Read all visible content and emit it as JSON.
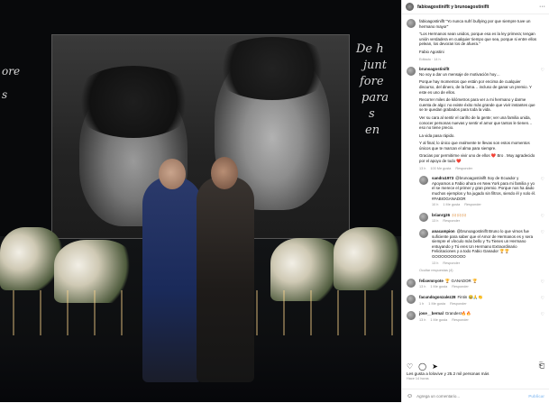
{
  "post": {
    "author": "fabioagostiniflt",
    "collaborator": "brunoagostiniflt",
    "header_text": "fabioagostiniflt y brunoagostiniflt",
    "caption": [
      "fabioagostiniflt \"Yo nunca sufrí bullying por que siempre tuve un hermano mayor\"",
      "\"Los Hermanos sean unidos, porque esa es la ley primera; tengan unión verdadera en cualquier tiempo que sea, porque si entre ellos pelean, los devoran los de afuera.\"",
      "Fabio Agostini"
    ],
    "caption_edit": "Editado · 14 h",
    "overlay_script_right": [
      "De h",
      "junt",
      "fore",
      "para",
      "s",
      "en"
    ],
    "overlay_script_left": [
      "ore",
      "s"
    ]
  },
  "comments": [
    {
      "user": "brunoagostiniflt",
      "paragraphs": [
        "No voy a dar un mensaje de motivación hoy…",
        "Porque hay momentos que están por encima de cualquier discurso, del dinero, de la fama… incluso de ganar un premio. Y este es uno de ellos.",
        "Recorrer miles de kilómetros para ver a mi hermano y darme cuenta de algo: no existe éxito más grande que vivir instantes que se te quedan grabados para toda la vida.",
        "Ver su cara al sentir el cariño de la gente; ver una familia unida, conocer personas nuevas y sentir el amor que tantos le tienen… eso no tiene precio.",
        "La vida pasa rápido.",
        "Y al final, lo único que realmente te llevas son estos momentos únicos que te marcan el alma para siempre.",
        "Gracias por permitirme vivir uno de ellos ❤️ Bro . Muy agradecido por el apoyo de todo ❤️"
      ],
      "time": "13 h",
      "likes": "100 Me gusta",
      "reply": "Responder",
      "replies": [
        {
          "user": "sandra1973",
          "text": "@brunoagostiniflt Soy de Ecuador y Apoyamos a Fabio ahora en New York para mi familia y yo el se merece el primer y gran premio. Porque nos ha dado muchos ejemplos y ha jugado sin filtros, siendo él y solo él. #FABIOGANADOR",
          "time": "10 h",
          "likes": "1 Me gusta",
          "reply": "Responder"
        },
        {
          "user": "brianrg26",
          "text": "🙌🏻🙌🏻🙌🏻",
          "time": "13 h",
          "likes": "",
          "reply": "Responder"
        },
        {
          "user": "anacampion",
          "text": "@brunoagostiniflt Bruno lo que vimos fue suficiente para saber que el Amor de Hermanos es y sera siempre el vínculo más bello y Tu Tienes un Hermano entuyando y Tú eres Un Hermano Extraordinario Felicitaciones y a todo Fabio Ganador 🏆🏆 GOOOOOOOOOO",
          "time": "13 h",
          "likes": "",
          "reply": "Responder"
        }
      ],
      "thread_toggle": "Ocultar respuestas (4)"
    },
    {
      "user": "felixemnyote",
      "text": "🏆 GANADOR 🏆",
      "time": "13 h",
      "likes": "1 Me gusta",
      "reply": "Responder"
    },
    {
      "user": "facundogonzalez28",
      "text": "Fintin 😂🙏👏",
      "time": "1 h",
      "likes": "1 Me gusta",
      "reply": "Responder"
    },
    {
      "user": "jose__bernal",
      "text": "Grandes!🔥🔥",
      "time": "13 h",
      "likes": "1 Me gusta",
      "reply": "Responder"
    }
  ],
  "footer": {
    "likes_text": "Les gusta a lolovive y 25.2 mil personas más",
    "date": "Hace 14 horas",
    "comment_placeholder": "Agrega un comentario...",
    "publish": "Publicar"
  },
  "icons": {
    "heart": "♡",
    "comment": "◯",
    "share": "➤",
    "save": "⎗",
    "more": "···",
    "emoji": "☺"
  }
}
